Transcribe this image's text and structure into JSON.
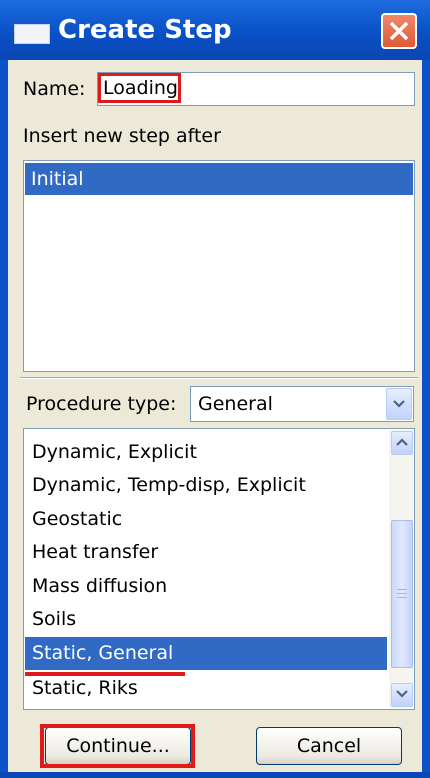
{
  "window": {
    "title": "Create Step"
  },
  "name_field": {
    "label": "Name:",
    "value": "Loading"
  },
  "insert_label": "Insert new step after",
  "steps": [
    "Initial"
  ],
  "procedure": {
    "label": "Procedure type:",
    "selected": "General",
    "items": [
      "Dynamic, Explicit",
      "Dynamic, Temp-disp, Explicit",
      "Geostatic",
      "Heat transfer",
      "Mass diffusion",
      "Soils",
      "Static, General",
      "Static, Riks"
    ],
    "selected_item": "Static, General"
  },
  "buttons": {
    "continue": "Continue...",
    "cancel": "Cancel"
  },
  "colors": {
    "titlebar": "#0a50c6",
    "selection": "#316ac5",
    "annotation": "#e01a1a",
    "dialog_bg": "#ece9d8"
  }
}
